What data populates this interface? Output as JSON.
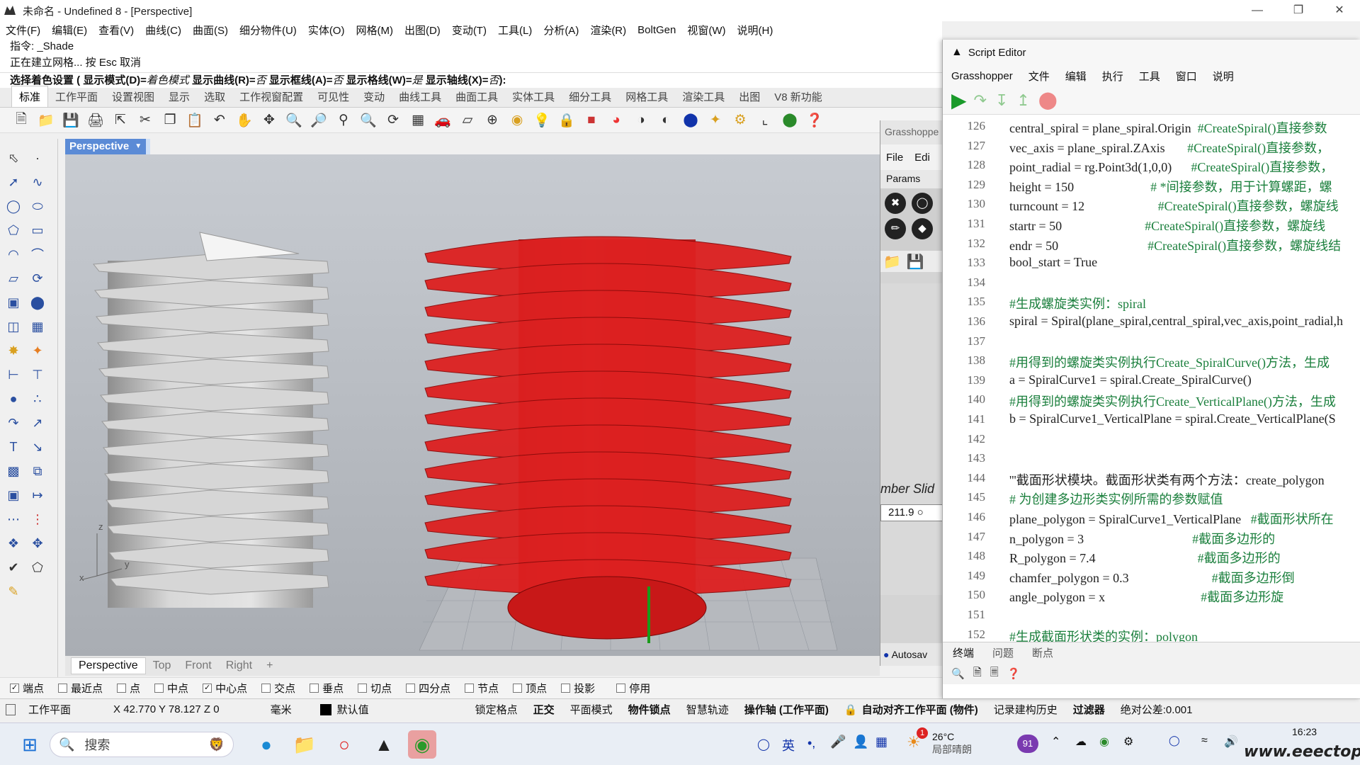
{
  "rhino": {
    "title": "未命名 - Undefined 8  - [Perspective]",
    "menu": [
      "文件(F)",
      "编辑(E)",
      "查看(V)",
      "曲线(C)",
      "曲面(S)",
      "细分物件(U)",
      "实体(O)",
      "网格(M)",
      "出图(D)",
      "变动(T)",
      "工具(L)",
      "分析(A)",
      "渲染(R)",
      "BoltGen",
      "视窗(W)",
      "说明(H)"
    ],
    "command_history": [
      "指令: _Shade",
      "正在建立网格... 按 Esc 取消"
    ],
    "command_line": {
      "prefix": "选择着色设置 ( 显示模式(",
      "p1": "D)=",
      "v1": "着色模式",
      "p2": "  显示曲线(R)=",
      "v2": "否",
      "p3": "  显示框线(A)=",
      "v3": "否",
      "p4": "  显示格线(W)=",
      "v4": "是",
      "p5": "  显示轴线(X)=",
      "v5": "否",
      "suffix": "):"
    },
    "tabs": [
      "标准",
      "工作平面",
      "设置视图",
      "显示",
      "选取",
      "工作视窗配置",
      "可见性",
      "变动",
      "曲线工具",
      "曲面工具",
      "实体工具",
      "细分工具",
      "网格工具",
      "渲染工具",
      "出图",
      "V8 新功能"
    ],
    "viewport_title": "Perspective",
    "viewport_tabs": [
      "Perspective",
      "Top",
      "Front",
      "Right",
      "+"
    ],
    "axis": {
      "z": "z",
      "y": "y",
      "x": "x"
    },
    "osnaps": [
      {
        "label": "端点",
        "checked": true
      },
      {
        "label": "最近点",
        "checked": false
      },
      {
        "label": "点",
        "checked": false
      },
      {
        "label": "中点",
        "checked": false
      },
      {
        "label": "中心点",
        "checked": true
      },
      {
        "label": "交点",
        "checked": false
      },
      {
        "label": "垂点",
        "checked": false
      },
      {
        "label": "切点",
        "checked": false
      },
      {
        "label": "四分点",
        "checked": false
      },
      {
        "label": "节点",
        "checked": false
      },
      {
        "label": "顶点",
        "checked": false
      },
      {
        "label": "投影",
        "checked": false
      },
      {
        "label": "停用",
        "checked": false
      }
    ],
    "status": {
      "cplane": "工作平面",
      "coords": "X 42.770 Y 78.127 Z 0",
      "units": "毫米",
      "layer": "默认值",
      "items": [
        "锁定格点",
        "正交",
        "平面模式",
        "物件锁点",
        "智慧轨迹",
        "操作轴 (工作平面)",
        "自动对齐工作平面 (物件)",
        "记录建构历史",
        "过滤器",
        "绝对公差:0.001"
      ]
    }
  },
  "grasshopper": {
    "title": "Grasshoppe",
    "menu": [
      "File",
      "Edi"
    ],
    "tab": "Params",
    "slider_label": "mber Slid",
    "slider_value": "211.9",
    "autosave": "Autosav"
  },
  "script_editor": {
    "title": "Script Editor",
    "menu": [
      "Grasshopper",
      "文件",
      "编辑",
      "执行",
      "工具",
      "窗口",
      "说明"
    ],
    "bottom_tabs": [
      "终端",
      "问题",
      "断点"
    ],
    "lines": [
      {
        "n": "126",
        "code": "central_spiral = plane_spiral.Origin",
        "comment": "  #CreateSpiral()直接参数"
      },
      {
        "n": "127",
        "code": "vec_axis = plane_spiral.ZAxis",
        "comment": "       #CreateSpiral()直接参数，"
      },
      {
        "n": "128",
        "code": "point_radial = rg.Point3d(1,0,0)",
        "comment": "      #CreateSpiral()直接参数，"
      },
      {
        "n": "129",
        "code": "height = 150",
        "comment": "                        # *间接参数，用于计算螺距，螺"
      },
      {
        "n": "130",
        "code": "turncount = 12",
        "comment": "                       #CreateSpiral()直接参数，螺旋线"
      },
      {
        "n": "131",
        "code": "startr = 50",
        "comment": "                          #CreateSpiral()直接参数，螺旋线"
      },
      {
        "n": "132",
        "code": "endr = 50",
        "comment": "                            #CreateSpiral()直接参数，螺旋线结"
      },
      {
        "n": "133",
        "code": "bool_start = True",
        "comment": ""
      },
      {
        "n": "134",
        "code": "",
        "comment": ""
      },
      {
        "n": "135",
        "code": "",
        "comment": "#生成螺旋类实例：spiral"
      },
      {
        "n": "136",
        "code": "spiral = Spiral(plane_spiral,central_spiral,vec_axis,point_radial,h",
        "comment": ""
      },
      {
        "n": "137",
        "code": "",
        "comment": ""
      },
      {
        "n": "138",
        "code": "",
        "comment": "#用得到的螺旋类实例执行Create_SpiralCurve()方法，生成"
      },
      {
        "n": "139",
        "code": "a = SpiralCurve1 = spiral.Create_SpiralCurve()",
        "comment": ""
      },
      {
        "n": "140",
        "code": "",
        "comment": "#用得到的螺旋类实例执行Create_VerticalPlane()方法，生成"
      },
      {
        "n": "141",
        "code": "b = SpiralCurve1_VerticalPlane = spiral.Create_VerticalPlane(S",
        "comment": ""
      },
      {
        "n": "142",
        "code": "",
        "comment": ""
      },
      {
        "n": "143",
        "code": "",
        "comment": ""
      },
      {
        "n": "144",
        "code": "'''截面形状模块。截面形状类有两个方法：create_polygon",
        "comment": ""
      },
      {
        "n": "145",
        "code": "",
        "comment": "# 为创建多边形类实例所需的参数赋值"
      },
      {
        "n": "146",
        "code": "plane_polygon = SpiralCurve1_VerticalPlane",
        "comment": "   #截面形状所在"
      },
      {
        "n": "147",
        "code": "n_polygon = 3",
        "comment": "                                  #截面多边形的"
      },
      {
        "n": "148",
        "code": "R_polygon = 7.4",
        "comment": "                                #截面多边形的"
      },
      {
        "n": "149",
        "code": "chamfer_polygon = 0.3",
        "comment": "                          #截面多边形倒"
      },
      {
        "n": "150",
        "code": "angle_polygon = x",
        "comment": "                              #截面多边形旋"
      },
      {
        "n": "151",
        "code": "",
        "comment": ""
      },
      {
        "n": "152",
        "code": "",
        "comment": "#生成截面形状类的实例：polygon"
      }
    ]
  },
  "taskbar": {
    "search": "搜索",
    "weather_temp": "26°C",
    "weather_desc": "局部晴朗",
    "ime": "英",
    "badge": "91",
    "time": "16:23",
    "watermark": "www.eeectop.com",
    "notif": "1"
  },
  "colors": {
    "accent": "#5b8bd6",
    "red_screw": "#d81e1e",
    "gray_screw": "#c9c9c9",
    "comment": "#1a7f3c",
    "number": "#3a6fc4"
  }
}
